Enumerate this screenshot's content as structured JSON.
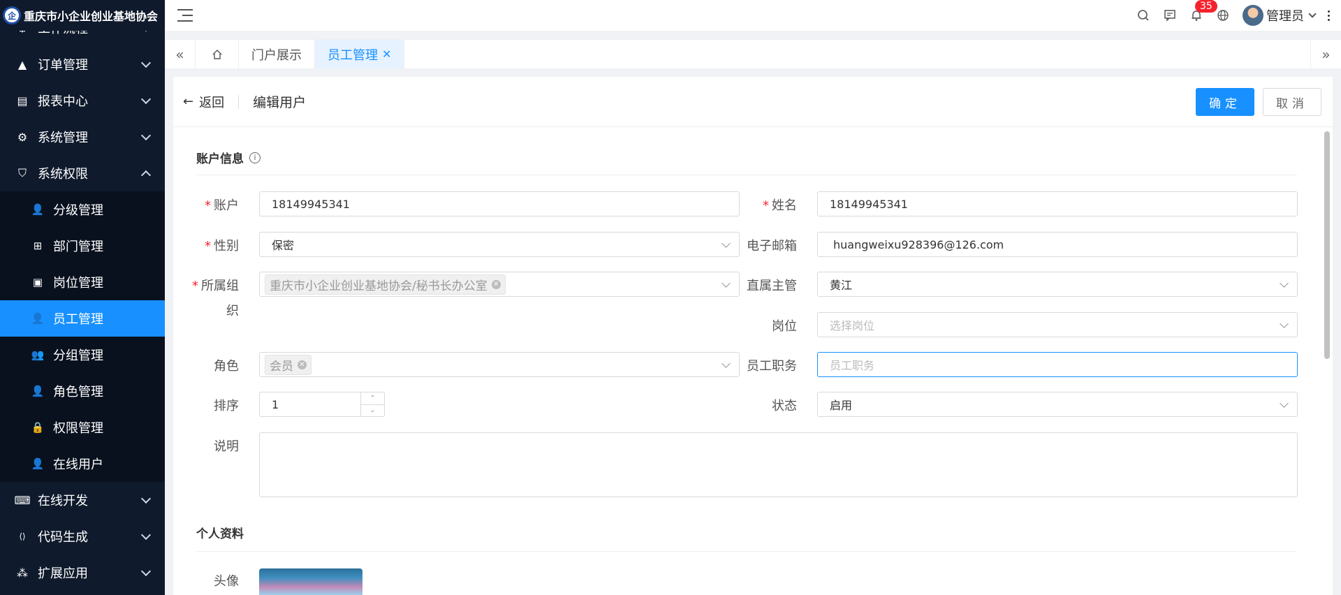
{
  "app": {
    "title": "重庆市小企业创业基地协会",
    "logo_glyph": "企"
  },
  "sidebar": {
    "partial_top": "工作流程",
    "items": [
      {
        "label": "订单管理",
        "icon": "triangle-icon",
        "glyph": "▲"
      },
      {
        "label": "报表中心",
        "icon": "report-icon",
        "glyph": "▤"
      },
      {
        "label": "系统管理",
        "icon": "gear-icon",
        "glyph": "⚙"
      },
      {
        "label": "系统权限",
        "icon": "shield-icon",
        "glyph": "⛉"
      }
    ],
    "sub_items": [
      {
        "label": "分级管理",
        "icon": "user-icon",
        "glyph": "👤"
      },
      {
        "label": "部门管理",
        "icon": "org-icon",
        "glyph": "⊞"
      },
      {
        "label": "岗位管理",
        "icon": "badge-icon",
        "glyph": "▣"
      },
      {
        "label": "员工管理",
        "icon": "user-icon",
        "glyph": "👤"
      },
      {
        "label": "分组管理",
        "icon": "group-icon",
        "glyph": "👥"
      },
      {
        "label": "角色管理",
        "icon": "role-icon",
        "glyph": "👤"
      },
      {
        "label": "权限管理",
        "icon": "lock-icon",
        "glyph": "🔒"
      },
      {
        "label": "在线用户",
        "icon": "online-user-icon",
        "glyph": "👤"
      }
    ],
    "bottom_items": [
      {
        "label": "在线开发",
        "icon": "terminal-icon",
        "glyph": "⌨"
      },
      {
        "label": "代码生成",
        "icon": "code-icon",
        "glyph": "⟨⟩"
      },
      {
        "label": "扩展应用",
        "icon": "apps-icon",
        "glyph": "⁂"
      }
    ]
  },
  "topbar": {
    "notification_count": "35",
    "user_name": "管理员"
  },
  "tabs": {
    "items": [
      "门户展示",
      "员工管理"
    ]
  },
  "header": {
    "back_label": "返回",
    "title": "编辑用户",
    "confirm_label": "确定",
    "cancel_label": "取消"
  },
  "sections": {
    "account": "账户信息",
    "profile": "个人资料"
  },
  "form": {
    "account_label": "账户",
    "account_value": "18149945341",
    "name_label": "姓名",
    "name_value": "18149945341",
    "gender_label": "性别",
    "gender_value": "保密",
    "email_label": "电子邮箱",
    "email_value": "huangweixu928396@126.com",
    "org_label_1": "所属组",
    "org_label_2": "织",
    "org_value": "重庆市小企业创业基地协会/秘书长办公室",
    "manager_label": "直属主管",
    "manager_value": "黄江",
    "post_label": "岗位",
    "post_placeholder": "选择岗位",
    "role_label": "角色",
    "role_value": "会员",
    "duty_label": "员工职务",
    "duty_placeholder": "员工职务",
    "sort_label": "排序",
    "sort_value": "1",
    "status_label": "状态",
    "status_value": "启用",
    "desc_label": "说明",
    "avatar_label": "头像"
  }
}
